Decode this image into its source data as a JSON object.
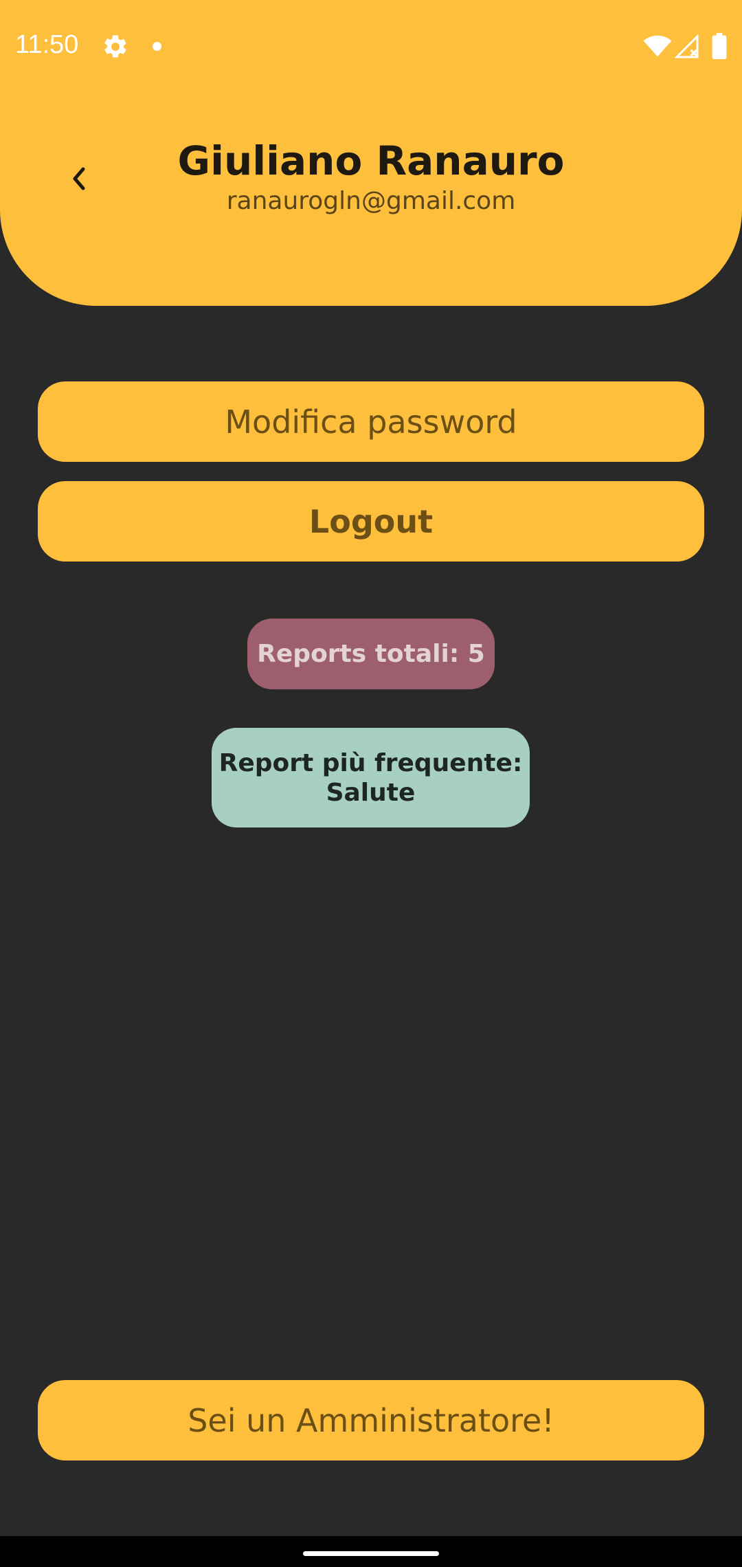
{
  "status_bar": {
    "time": "11:50",
    "icons": [
      "settings-gear-icon",
      "notification-dot-icon",
      "wifi-icon",
      "cell-signal-no-data-icon",
      "battery-icon"
    ]
  },
  "header": {
    "back_icon": "chevron-left-icon",
    "name": "Giuliano Ranauro",
    "email": "ranaurogln@gmail.com"
  },
  "actions": {
    "change_password_label": "Modifica password",
    "logout_label": "Logout"
  },
  "stats": {
    "total_reports": "Reports totali: 5",
    "most_frequent_line1": "Report più frequente:",
    "most_frequent_line2": "Salute"
  },
  "footer": {
    "admin_label": "Sei un Amministratore!"
  },
  "colors": {
    "accent": "#FEBF3D",
    "background": "#292929",
    "total_badge": "#9D5F6D",
    "frequent_badge": "#A7D0C3"
  }
}
